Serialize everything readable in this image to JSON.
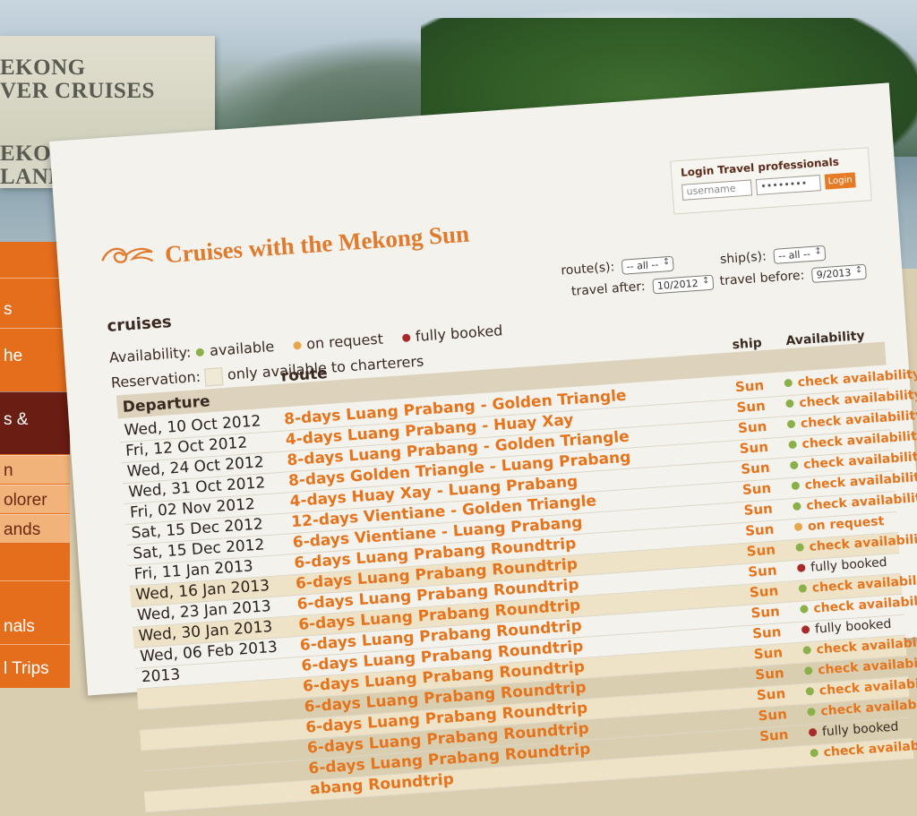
{
  "brand": {
    "line1": "EKONG",
    "line2": "VER CRUISES",
    "line3": "EKONG",
    "line4": "LANDS TOURS"
  },
  "sidebar": {
    "items": [
      {
        "label": "s"
      },
      {
        "label": "he"
      },
      {
        "label": "s &"
      },
      {
        "label": "n"
      },
      {
        "label": "olorer"
      },
      {
        "label": "ands"
      },
      {
        "label": "nals"
      },
      {
        "label": "l Trips"
      }
    ]
  },
  "login": {
    "title": "Login Travel professionals",
    "username_placeholder": "username",
    "password_value": "••••••••",
    "button": "Login"
  },
  "page": {
    "title": "Cruises with the Mekong Sun"
  },
  "legend": {
    "section": "cruises",
    "availability_label": "Availability:",
    "available": "available",
    "on_request": "on request",
    "fully_booked": "fully booked",
    "reservation_label": "Reservation:",
    "charter": "only available to charterers"
  },
  "filters": {
    "route_label": "route(s):",
    "route_value": "-- all --",
    "ship_label": "ship(s):",
    "ship_value": "-- all --",
    "after_label": "travel after:",
    "after_value": "10/2012",
    "before_label": "travel before:",
    "before_value": "9/2013"
  },
  "table": {
    "headers": {
      "departure": "Departure",
      "route": "route",
      "ship": "ship",
      "availability": "Availability"
    },
    "rows": [
      {
        "date": "Wed, 10 Oct 2012",
        "route": "8-days Luang Prabang - Golden Triangle",
        "ship": "Sun",
        "status": "green",
        "avail": "check availability",
        "shaded": false
      },
      {
        "date": "Fri, 12 Oct 2012",
        "route": "4-days Luang Prabang - Huay Xay",
        "ship": "Sun",
        "status": "green",
        "avail": "check availability",
        "shaded": false
      },
      {
        "date": "Wed, 24 Oct 2012",
        "route": "8-days Luang Prabang - Golden Triangle",
        "ship": "Sun",
        "status": "green",
        "avail": "check availability",
        "shaded": false
      },
      {
        "date": "Wed, 31 Oct 2012",
        "route": "8-days Golden Triangle - Luang Prabang",
        "ship": "Sun",
        "status": "green",
        "avail": "check availability",
        "shaded": false
      },
      {
        "date": "Fri, 02 Nov 2012",
        "route": "4-days Huay Xay - Luang Prabang",
        "ship": "Sun",
        "status": "green",
        "avail": "check availability",
        "shaded": false
      },
      {
        "date": "Sat, 15 Dec 2012",
        "route": "12-days Vientiane - Golden Triangle",
        "ship": "Sun",
        "status": "green",
        "avail": "check availability",
        "shaded": false
      },
      {
        "date": "Sat, 15 Dec 2012",
        "route": "6-days Vientiane - Luang Prabang",
        "ship": "Sun",
        "status": "green",
        "avail": "check availability",
        "shaded": false
      },
      {
        "date": "Fri, 11 Jan 2013",
        "route": "6-days Luang Prabang Roundtrip",
        "ship": "Sun",
        "status": "orange",
        "avail": "on request",
        "shaded": false
      },
      {
        "date": "Wed, 16 Jan 2013",
        "route": "6-days Luang Prabang Roundtrip",
        "ship": "Sun",
        "status": "green",
        "avail": "check availability",
        "shaded": true
      },
      {
        "date": "Wed, 23 Jan 2013",
        "route": "6-days Luang Prabang Roundtrip",
        "ship": "Sun",
        "status": "red",
        "avail": "fully booked",
        "shaded": false
      },
      {
        "date": "Wed, 30 Jan 2013",
        "route": "6-days Luang Prabang Roundtrip",
        "ship": "Sun",
        "status": "green",
        "avail": "check availability",
        "shaded": true
      },
      {
        "date": "Wed, 06 Feb 2013",
        "route": "6-days Luang Prabang Roundtrip",
        "ship": "Sun",
        "status": "green",
        "avail": "check availability",
        "shaded": false
      },
      {
        "date": "2013",
        "route": "6-days Luang Prabang Roundtrip",
        "ship": "Sun",
        "status": "red",
        "avail": "fully booked",
        "shaded": false
      },
      {
        "date": "",
        "route": "6-days Luang Prabang Roundtrip",
        "ship": "Sun",
        "status": "green",
        "avail": "check availability",
        "shaded": true
      },
      {
        "date": "",
        "route": "6-days Luang Prabang Roundtrip",
        "ship": "Sun",
        "status": "green",
        "avail": "check availability",
        "shaded": false
      },
      {
        "date": "",
        "route": "6-days Luang Prabang Roundtrip",
        "ship": "Sun",
        "status": "green",
        "avail": "check availability",
        "shaded": true
      },
      {
        "date": "",
        "route": "6-days Luang Prabang Roundtrip",
        "ship": "Sun",
        "status": "green",
        "avail": "check availability",
        "shaded": false
      },
      {
        "date": "",
        "route": "6-days Luang Prabang Roundtrip",
        "ship": "Sun",
        "status": "red",
        "avail": "fully booked",
        "shaded": false
      },
      {
        "date": "",
        "route": "abang Roundtrip",
        "ship": "",
        "status": "green",
        "avail": "check availability",
        "shaded": true
      }
    ]
  },
  "colors": {
    "accent": "#e5741d",
    "available": "#8bb04a",
    "on_request": "#e6a64a",
    "fully_booked": "#a82a2a"
  }
}
